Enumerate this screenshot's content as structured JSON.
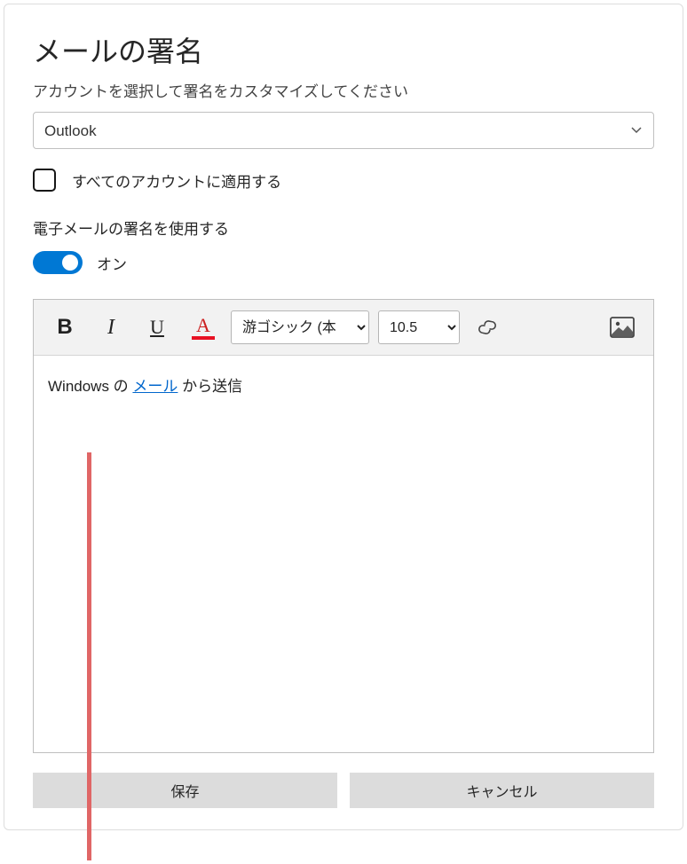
{
  "title": "メールの署名",
  "subtitle": "アカウントを選択して署名をカスタマイズしてください",
  "account": {
    "selected": "Outlook"
  },
  "applyAll": {
    "label": "すべてのアカウントに適用する"
  },
  "useSignature": {
    "label": "電子メールの署名を使用する",
    "state": "オン"
  },
  "toolbar": {
    "bold": "B",
    "italic": "I",
    "underline": "U",
    "fontColorLetter": "A",
    "fontFamily": "游ゴシック (本",
    "fontSize": "10.5"
  },
  "signature": {
    "prefix": "Windows の ",
    "linkText": "メール",
    "suffix": " から送信"
  },
  "buttons": {
    "save": "保存",
    "cancel": "キャンセル"
  }
}
